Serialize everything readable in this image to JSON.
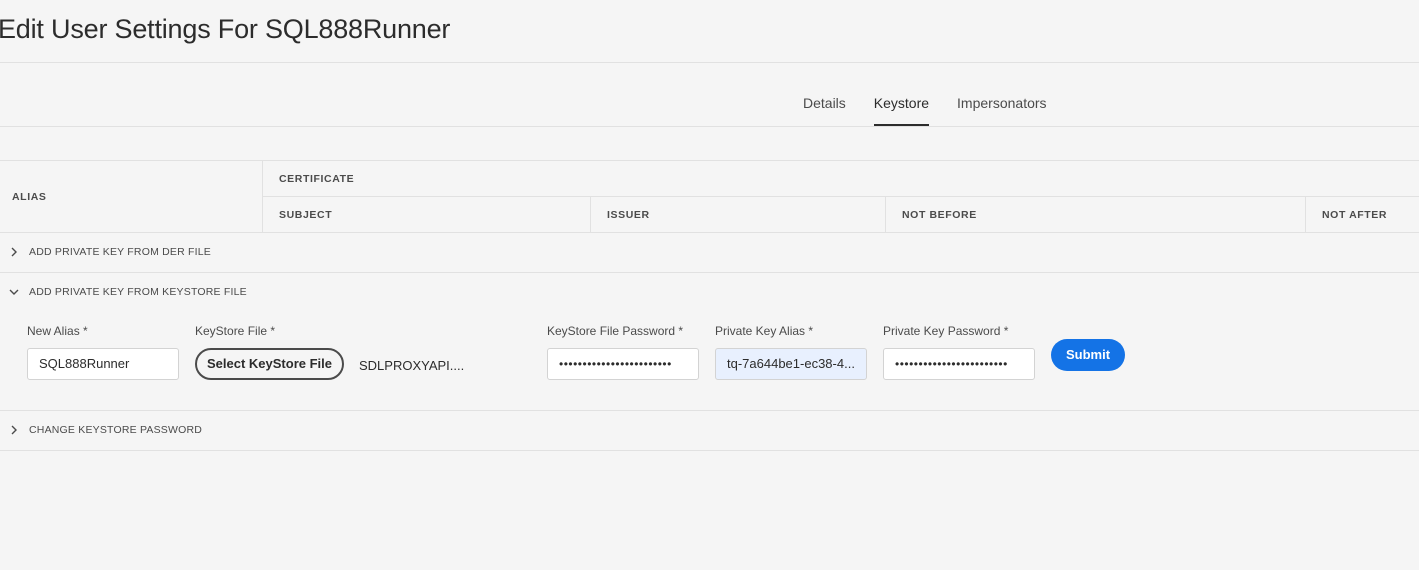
{
  "page": {
    "title": "Edit User Settings For SQL888Runner"
  },
  "tabs": [
    {
      "label": "Details",
      "active": false
    },
    {
      "label": "Keystore",
      "active": true
    },
    {
      "label": "Impersonators",
      "active": false
    }
  ],
  "table": {
    "alias_header": "ALIAS",
    "certificate_header": "CERTIFICATE",
    "columns": [
      "SUBJECT",
      "ISSUER",
      "NOT BEFORE",
      "NOT AFTER"
    ]
  },
  "accordions": [
    {
      "label": "ADD PRIVATE KEY FROM DER FILE",
      "expanded": false
    },
    {
      "label": "ADD PRIVATE KEY FROM KEYSTORE FILE",
      "expanded": true
    },
    {
      "label": "CHANGE KEYSTORE PASSWORD",
      "expanded": false
    }
  ],
  "form": {
    "new_alias": {
      "label": "New Alias *",
      "value": "SQL888Runner"
    },
    "keystore_file": {
      "label": "KeyStore File *",
      "button_label": "Select KeyStore File",
      "selected_file": "SDLPROXYAPI...."
    },
    "keystore_password": {
      "label": "KeyStore File Password *",
      "value": "••••••••••••••••••••••••"
    },
    "private_key_alias": {
      "label": "Private Key Alias *",
      "value": "tq-7a644be1-ec38-4..."
    },
    "private_key_password": {
      "label": "Private Key Password *",
      "value": "••••••••••••••••••••••••"
    },
    "submit_label": "Submit"
  },
  "icons": {
    "collapsed": "chevron-right-icon",
    "expanded": "chevron-down-icon"
  },
  "colors": {
    "primary": "#1473e6",
    "background": "#f5f5f5",
    "autofill": "#e8f0fe"
  }
}
